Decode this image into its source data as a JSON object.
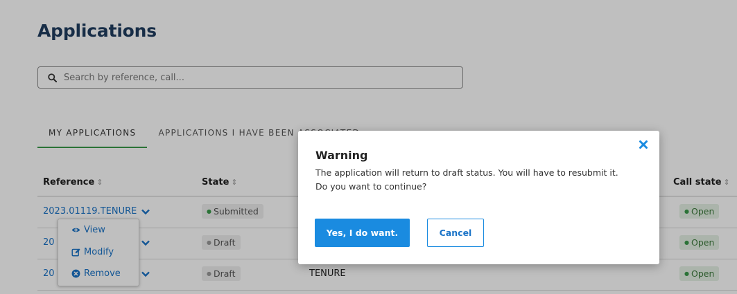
{
  "page": {
    "title": "Applications"
  },
  "search": {
    "placeholder": "Search by reference, call...",
    "value": ""
  },
  "tabs": [
    {
      "label": "MY APPLICATIONS",
      "active": true
    },
    {
      "label": "APPLICATIONS I HAVE BEEN ASSOCIATED",
      "active": false
    }
  ],
  "table": {
    "columns": [
      "Reference",
      "State",
      "Call state"
    ],
    "rows": [
      {
        "reference": "2023.01119.TENURE",
        "state": "Submitted",
        "call": "",
        "call_state": "Open"
      },
      {
        "reference": "20",
        "state": "Draft",
        "call": "",
        "call_state": "Open"
      },
      {
        "reference": "20",
        "state": "Draft",
        "call": "TENURE",
        "call_state": "Open"
      }
    ]
  },
  "action_menu": {
    "view": "View",
    "modify": "Modify",
    "remove": "Remove"
  },
  "modal": {
    "title": "Warning",
    "line1": "The application will return to draft status. You will have to resubmit it.",
    "line2": "Do you want to continue?",
    "confirm_label": "Yes, I do want.",
    "cancel_label": "Cancel"
  },
  "colors": {
    "accent": "#1a8be0",
    "link": "#1a73c7",
    "title": "#1f3c5f",
    "tab_active": "#3a9a4a",
    "open_badge_bg": "#e4f1e4",
    "overlay": "rgba(0,0,0,0.25)"
  },
  "icons": {
    "search": "search-icon",
    "chevron": "chevron-down-icon",
    "view": "eye-icon",
    "modify": "edit-icon",
    "remove": "remove-circle-icon",
    "close": "close-icon"
  }
}
